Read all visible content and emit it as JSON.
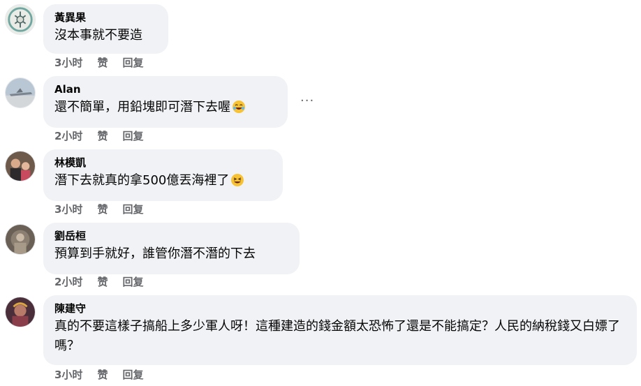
{
  "comments": [
    {
      "author": "黃異果",
      "text": "沒本事就不要造",
      "time": "3小时",
      "like": "赞",
      "reply": "回复"
    },
    {
      "author": "Alan",
      "text": "還不簡單，用鉛塊即可潛下去喔",
      "time": "2小时",
      "like": "赞",
      "reply": "回复",
      "emoji": "rolling-laughing-emoji"
    },
    {
      "author": "林模凱",
      "text": "潛下去就真的拿500億丟海裡了",
      "time": "3小时",
      "like": "赞",
      "reply": "回复",
      "emoji": "laughing-emoji"
    },
    {
      "author": "劉岳桓",
      "text": "預算到手就好，誰管你潛不潛的下去",
      "time": "2小时",
      "like": "赞",
      "reply": "回复"
    },
    {
      "author": "陳建守",
      "text": "真的不要這樣子搞船上多少軍人呀！這種建造的錢金額太恐怖了還是不能搞定？人民的納稅錢又白嫖了嗎？",
      "time": "3小时",
      "like": "赞",
      "reply": "回复"
    }
  ],
  "more_options": "···"
}
